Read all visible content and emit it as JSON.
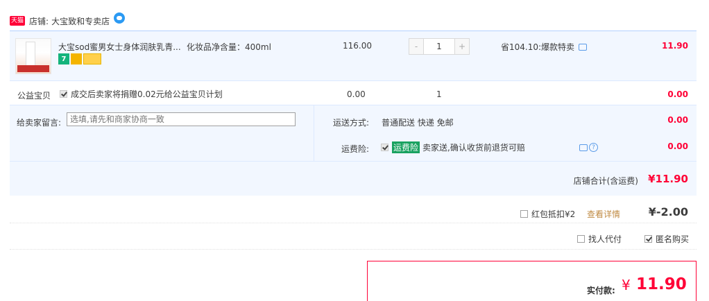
{
  "shop": {
    "badge": "天猫",
    "label": "店铺:",
    "name": "大宝致和专卖店"
  },
  "item": {
    "title": "大宝sod蜜男女士身体润肤乳青...",
    "spec": "化妆品净含量：400ml",
    "badge_7": "7",
    "price": "116.00",
    "qty": "1",
    "qty_minus": "-",
    "qty_plus": "+",
    "discount": "省104.10:爆款特卖",
    "total": "11.90"
  },
  "charity": {
    "label": "公益宝贝",
    "text": "成交后卖家将捐赠0.02元给公益宝贝计划",
    "price": "0.00",
    "qty": "1",
    "total": "0.00"
  },
  "message": {
    "label": "给卖家留言:",
    "placeholder": "选填,请先和商家协商一致"
  },
  "shipping": {
    "label": "运送方式:",
    "value": "普通配送 快递 免邮",
    "total": "0.00"
  },
  "insurance": {
    "label": "运费险:",
    "tag": "运费险",
    "text": "卖家送,确认收货前退货可赔",
    "help": "?",
    "total": "0.00"
  },
  "shop_total": {
    "label": "店铺合计(含运费)",
    "value": "¥11.90"
  },
  "redpack": {
    "label": "红包抵扣¥2",
    "link": "查看详情",
    "value": "¥-2.00"
  },
  "options": {
    "proxy_label": "找人代付",
    "anon_label": "匿名购买"
  },
  "payment": {
    "label": "实付款:",
    "currency": "¥",
    "value": "11.90"
  },
  "colors": {
    "accent_red": "#ff0036",
    "border_blue": "#b2d1ff",
    "row_bg": "#f2f7ff",
    "insurance_green": "#1aa260",
    "link_brown": "#c08b44"
  }
}
